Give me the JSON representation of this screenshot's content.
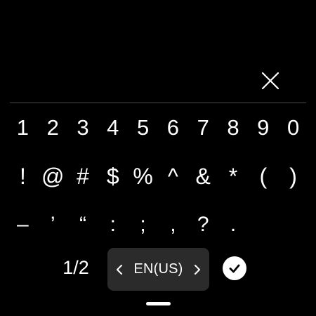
{
  "close_icon": "close-icon",
  "number_row": [
    "1",
    "2",
    "3",
    "4",
    "5",
    "6",
    "7",
    "8",
    "9",
    "0"
  ],
  "symbol_row": [
    "!",
    "@",
    "#",
    "$",
    "%",
    "^",
    "&",
    "*",
    "(",
    ")"
  ],
  "punct_row": [
    "–",
    "’",
    "“",
    ":",
    ";",
    ",",
    "?",
    "."
  ],
  "page_indicator": "1/2",
  "language": {
    "label": "EN(US)",
    "prev_icon": "chevron-left-icon",
    "next_icon": "chevron-right-icon"
  },
  "done_icon": "check-circle-icon",
  "colors": {
    "background": "#000000",
    "text": "#ffffff",
    "pill": "#2b2b2b",
    "divider": "#4a4a4a"
  }
}
